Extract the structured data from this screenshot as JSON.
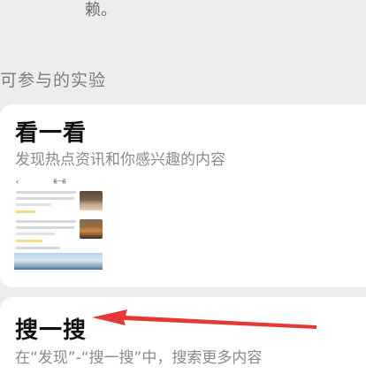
{
  "top_fragment": "赖。",
  "section": {
    "title": "可参与的实验"
  },
  "cards": [
    {
      "title": "看一看",
      "description": "发现热点资讯和你感兴趣的内容",
      "preview": {
        "back": "‹",
        "title": "看一看"
      }
    },
    {
      "title": "搜一搜",
      "description": "在“发现”-“搜一搜”中，搜索更多内容"
    }
  ],
  "colors": {
    "page_background": "#ededed",
    "card_background": "#ffffff",
    "arrow": "#e53935",
    "highlight": "#f0d36a"
  }
}
